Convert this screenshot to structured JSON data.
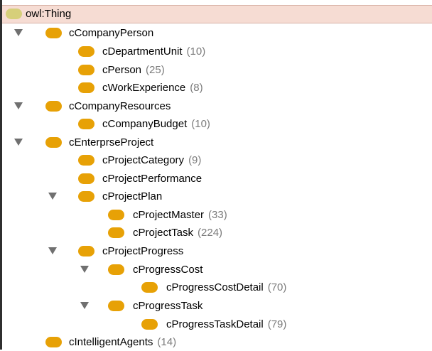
{
  "tree": {
    "root": {
      "label": "owl:Thing",
      "selected": true
    },
    "items": [
      {
        "label": "cCompanyPerson",
        "count": "",
        "expanded": true
      },
      {
        "label": "cDepartmentUnit",
        "count": "(10)"
      },
      {
        "label": "cPerson",
        "count": "(25)"
      },
      {
        "label": "cWorkExperience",
        "count": "(8)"
      },
      {
        "label": "cCompanyResources",
        "count": "",
        "expanded": true
      },
      {
        "label": "cCompanyBudget",
        "count": "(10)"
      },
      {
        "label": "cEnterprseProject",
        "count": "",
        "expanded": true
      },
      {
        "label": "cProjectCategory",
        "count": "(9)"
      },
      {
        "label": "cProjectPerformance",
        "count": ""
      },
      {
        "label": "cProjectPlan",
        "count": "",
        "expanded": true
      },
      {
        "label": "cProjectMaster",
        "count": "(33)"
      },
      {
        "label": "cProjectTask",
        "count": "(224)"
      },
      {
        "label": "cProjectProgress",
        "count": "",
        "expanded": true
      },
      {
        "label": "cProgressCost",
        "count": "",
        "expanded": true
      },
      {
        "label": "cProgressCostDetail",
        "count": "(70)"
      },
      {
        "label": "cProgressTask",
        "count": "",
        "expanded": true
      },
      {
        "label": "cProgressTaskDetail",
        "count": "(79)"
      },
      {
        "label": "cIntelligentAgents",
        "count": "(14)"
      }
    ]
  },
  "colors": {
    "class_bullet": "#e7a106",
    "root_bullet": "#d6cf7a",
    "selection": "#f6dcd3",
    "count_text": "#7b7b7b",
    "toggle": "#707070"
  },
  "icons": {
    "class": "class-bullet-icon",
    "root": "owl-thing-icon",
    "expanded": "expanded-triangle-icon"
  }
}
